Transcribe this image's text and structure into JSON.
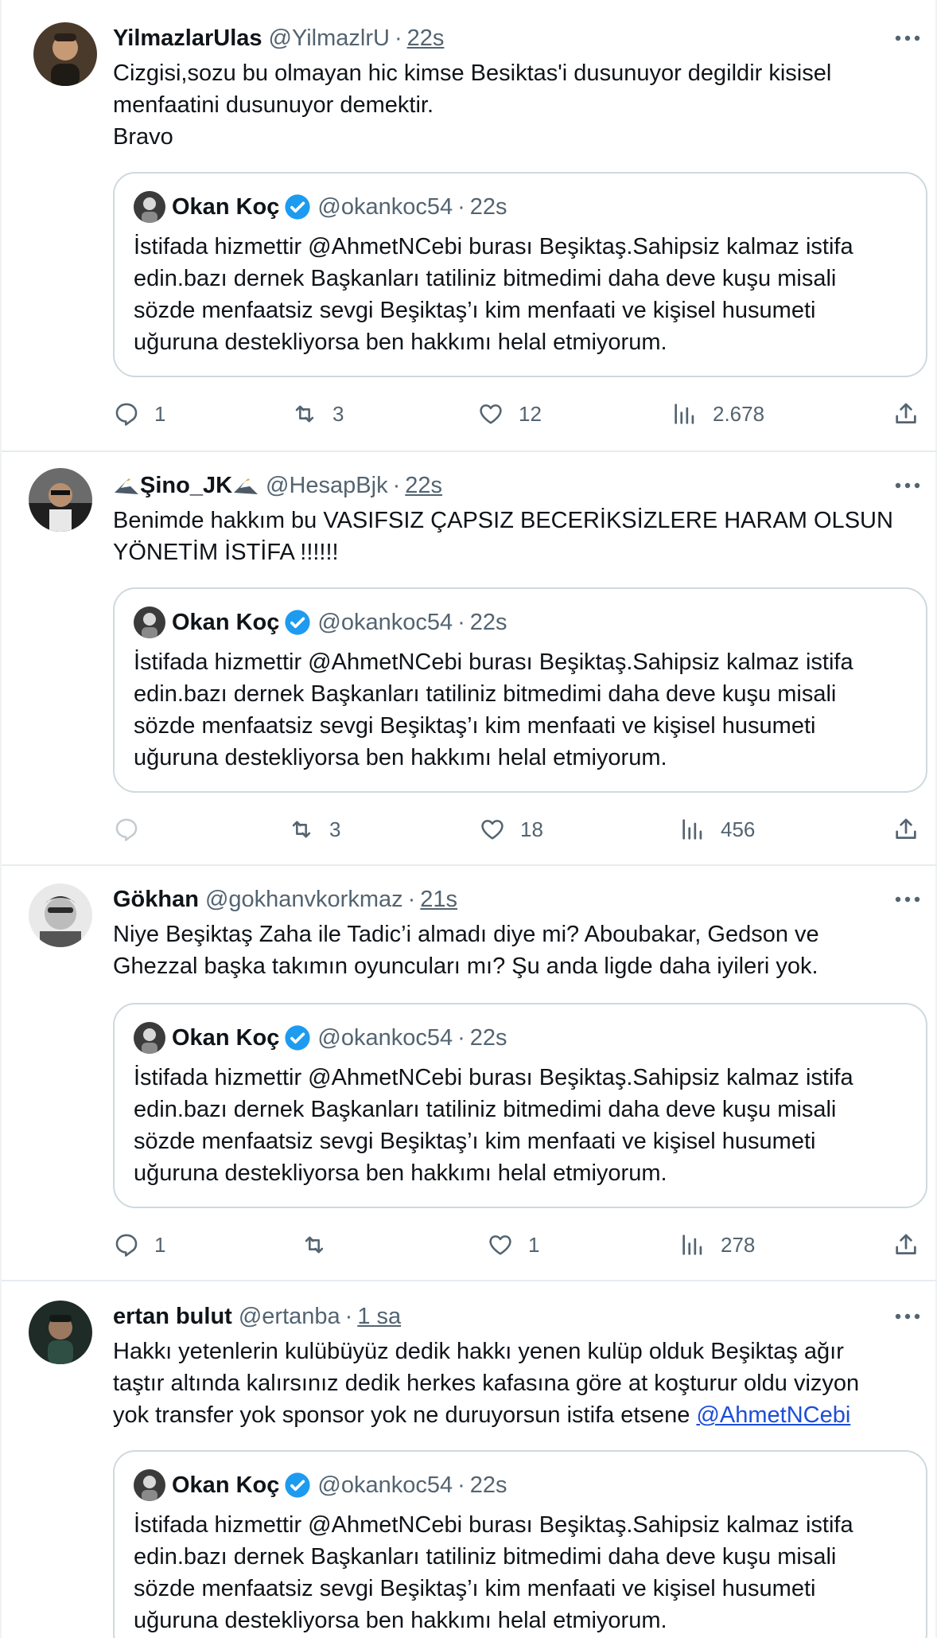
{
  "quoted": {
    "name": "Okan Koç",
    "handle": "@okankoc54",
    "time": "22s",
    "lines": [
      "İstifada hizmettir @AhmetNCebi burası Beşiktaş.Sahipsiz kalmaz istifa",
      "edin.bazı dernek Başkanları tatiliniz bitmedimi daha deve kuşu misali",
      "sözde menfaatsiz sevgi Beşiktaş’ı kim menfaati ve kişisel husumeti",
      "uğuruna destekliyorsa ben hakkımı helal etmiyorum."
    ]
  },
  "tweets": [
    {
      "name": "YilmazlarUlas",
      "handle": "@YilmazlrU",
      "time": "22s",
      "lines": [
        "Cizgisi,sozu bu olmayan hic kimse Besiktas'i dusunuyor degildir kisisel",
        "menfaatini dusunuyor demektir.",
        "Bravo"
      ],
      "replies": "1",
      "retweets": "3",
      "likes": "12",
      "views": "2.678"
    },
    {
      "name": "Şino_JK",
      "handle": "@HesapBjk",
      "time": "22s",
      "lines": [
        "Benimde hakkım bu VASIFSIZ ÇAPSIZ BECERİKSİZLERE HARAM OLSUN",
        "YÖNETİM İSTİFA !!!!!!"
      ],
      "replies": "",
      "retweets": "3",
      "likes": "18",
      "views": "456"
    },
    {
      "name": "Gökhan",
      "handle": "@gokhanvkorkmaz",
      "time": "21s",
      "lines": [
        "Niye Beşiktaş Zaha ile Tadic’i almadı diye mi? Aboubakar, Gedson ve",
        "Ghezzal başka takımın oyuncuları mı? Şu anda ligde daha iyileri yok."
      ],
      "replies": "1",
      "retweets": "",
      "likes": "1",
      "views": "278"
    },
    {
      "name": "ertan bulut",
      "handle": "@ertanba",
      "time": "1 sa",
      "lines": [
        "Hakkı yetenlerin kulübüyüz dedik hakkı yenen kulüp olduk Beşiktaş ağır",
        "taştır altında kalırsınız dedik herkes kafasına göre at koşturur oldu vizyon",
        "yok transfer yok sponsor yok ne duruyorsun istifa etsene "
      ],
      "mention": "@AhmetNCebi"
    }
  ]
}
